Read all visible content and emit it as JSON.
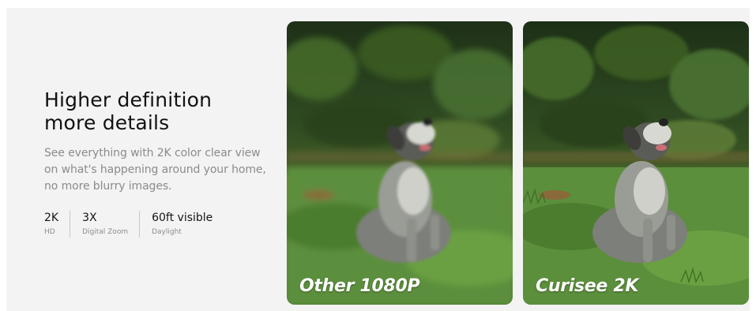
{
  "headline": {
    "line1": "Higher definition",
    "line2": "more details"
  },
  "description": {
    "line1": "See everything with 2K color clear view",
    "line2": "on what's happening around your home,",
    "line3": "no more blurry images."
  },
  "specs": [
    {
      "value": "2K",
      "label": "HD"
    },
    {
      "value": "3X",
      "label": "Digital Zoom"
    },
    {
      "value": "60ft visible",
      "label": "Daylight"
    }
  ],
  "comparison": {
    "left_caption": "Other 1080P",
    "right_caption": "Curisee 2K"
  },
  "colors": {
    "panel_background": "#f3f3f3",
    "headline": "#111111",
    "body_text": "#8b8b8b",
    "caption": "#ffffff",
    "foliage": "#2f4a22",
    "grass": "#5c8f3c"
  }
}
